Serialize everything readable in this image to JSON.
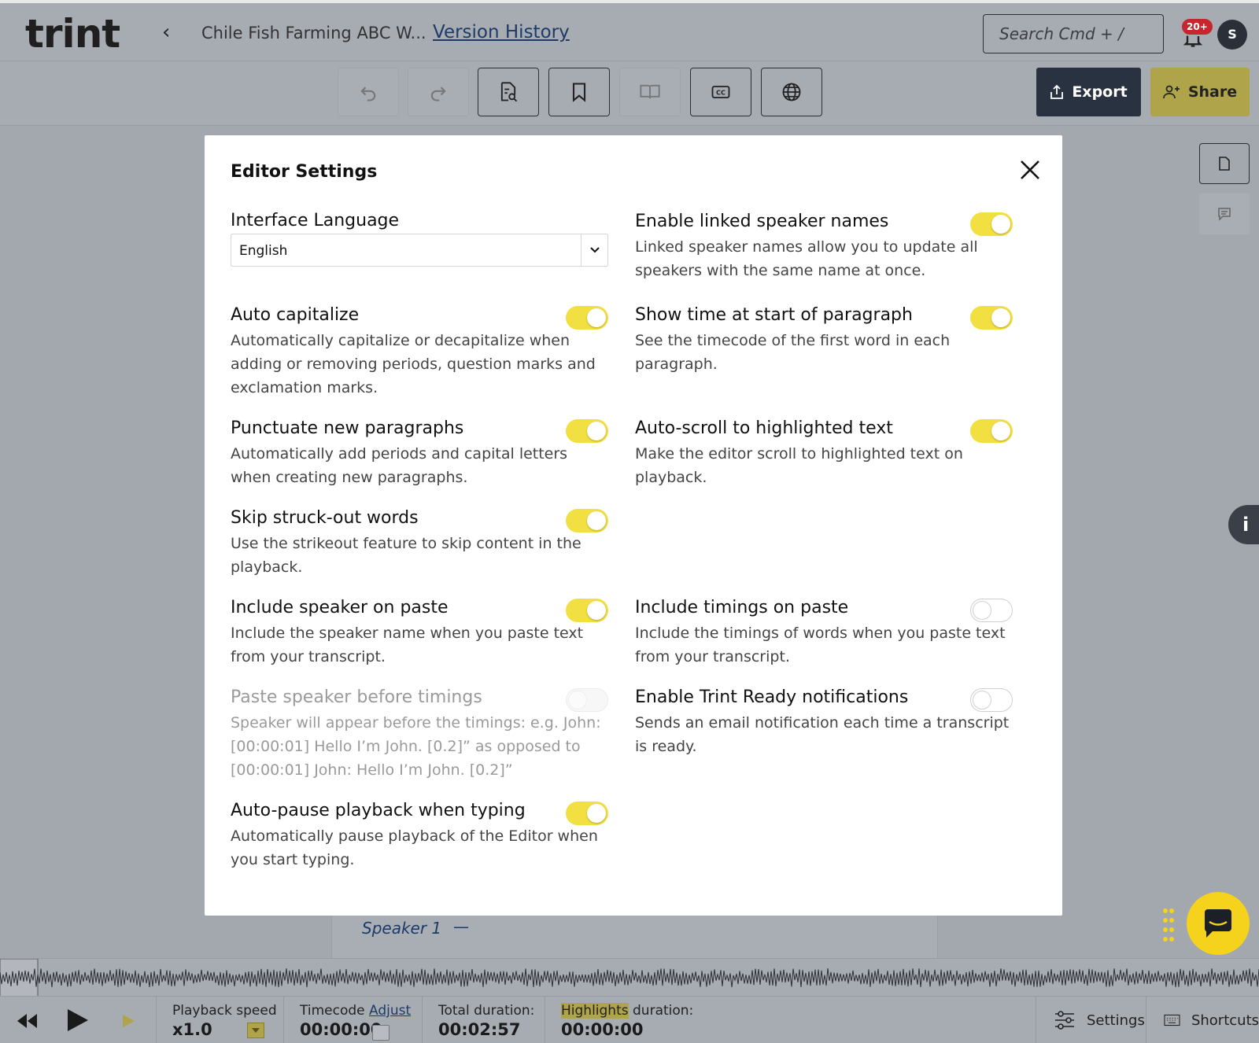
{
  "app": {
    "logo": "trint",
    "document_title": "Chile Fish Farming ABC W...",
    "version_history": "Version History",
    "search_placeholder": "Search   Cmd + /",
    "notifications_badge": "20+",
    "avatar_initial": "S"
  },
  "toolbar": {
    "export_label": "Export",
    "share_label": "Share",
    "icons": [
      "undo-icon",
      "redo-icon",
      "find-in-document-icon",
      "bookmark-icon",
      "book-icon",
      "closed-captions-icon",
      "globe-icon"
    ]
  },
  "transcript": {
    "speaker": "Speaker 1",
    "dash": "—"
  },
  "player": {
    "playback_speed_label": "Playback speed",
    "playback_speed_value": "x1.0",
    "timecode_label": "Timecode",
    "timecode_adjust": "Adjust",
    "timecode_value": "00:00:00",
    "total_duration_label": "Total duration:",
    "total_duration_value": "00:02:57",
    "highlights_label": "Highlights",
    "highlights_suffix": "duration:",
    "highlights_value": "00:00:00",
    "settings_label": "Settings",
    "shortcuts_label": "Shortcuts"
  },
  "modal": {
    "title": "Editor Settings",
    "interface_language_label": "Interface Language",
    "interface_language_value": "English",
    "settings_left": [
      {
        "title": "Auto capitalize",
        "desc": "Automatically capitalize or decapitalize when adding or removing periods, question marks and exclamation marks.",
        "state": "on"
      },
      {
        "title": "Punctuate new paragraphs",
        "desc": "Automatically add periods and capital letters when creating new paragraphs.",
        "state": "on"
      },
      {
        "title": "Skip struck-out words",
        "desc": "Use the strikeout feature to skip content in the playback.",
        "state": "on"
      },
      {
        "title": "Include speaker on paste",
        "desc": "Include the speaker name when you paste text from your transcript.",
        "state": "on"
      },
      {
        "title": "Paste speaker before timings",
        "desc": "Speaker will appear before the timings: e.g. John: [00:00:01] Hello I’m John. [0.2]” as opposed to [00:00:01] John: Hello I’m John. [0.2]”",
        "state": "disabled"
      },
      {
        "title": "Auto-pause playback when typing",
        "desc": "Automatically pause playback of the Editor when you start typing.",
        "state": "on"
      }
    ],
    "settings_right": [
      {
        "title": "Enable linked speaker names",
        "desc": "Linked speaker names allow you to update all speakers with the same name at once.",
        "state": "on"
      },
      {
        "title": "Show time at start of paragraph",
        "desc": "See the timecode of the first word in each paragraph.",
        "state": "on"
      },
      {
        "title": "Auto-scroll to highlighted text",
        "desc": "Make the editor scroll to highlighted text on playback.",
        "state": "on"
      },
      {
        "title": "Include timings on paste",
        "desc": "Include the timings of words when you paste text from your transcript.",
        "state": "off"
      },
      {
        "title": "Enable Trint Ready notifications",
        "desc": "Sends an email notification each time a transcript is ready.",
        "state": "off"
      }
    ]
  },
  "colors": {
    "toggle_on": "#f2df41",
    "share_button": "#b0a44a",
    "export_button": "#283240",
    "chat_button": "#f5d21b",
    "link": "#1e3a66"
  }
}
